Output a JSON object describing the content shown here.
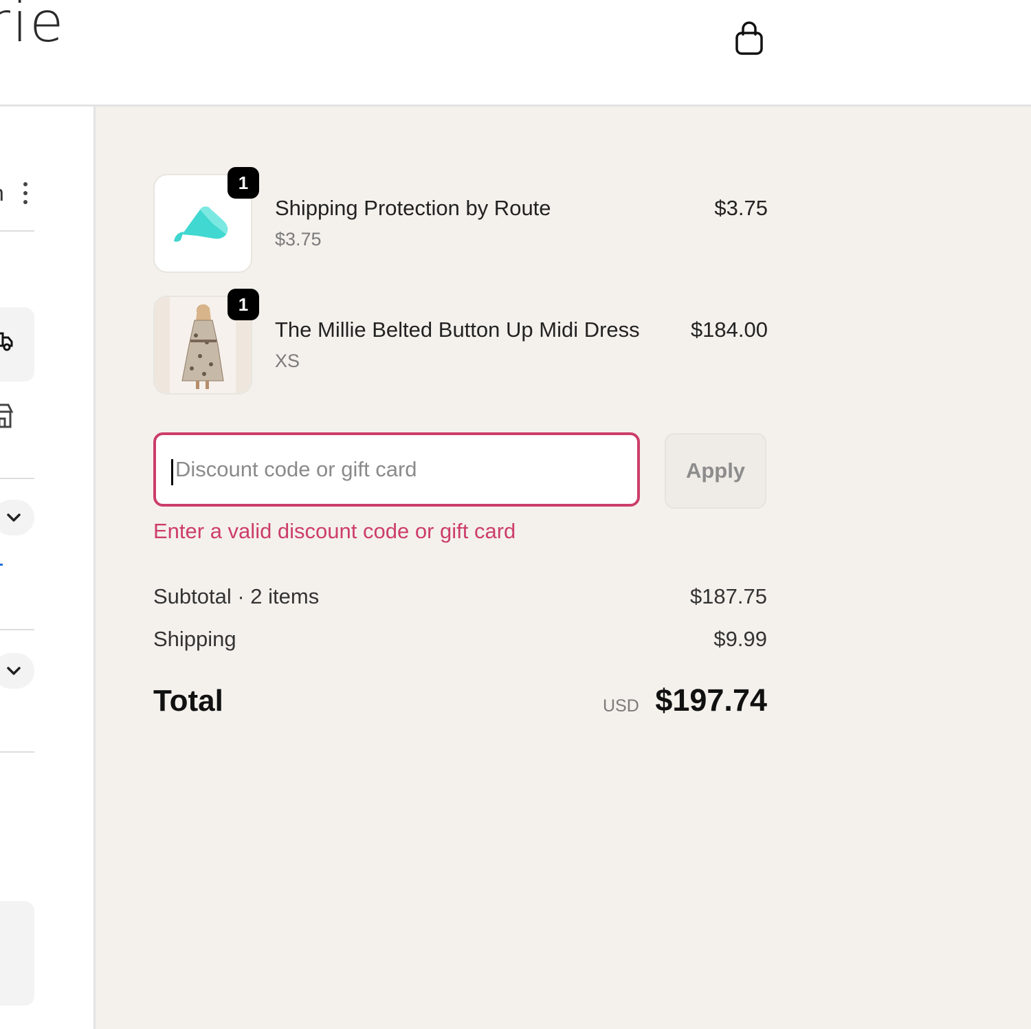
{
  "header": {
    "logo_text": "arie",
    "cart_icon": "shopping-bag-icon"
  },
  "left_panel": {
    "partial_text": "n",
    "icons": [
      "truck-icon",
      "store-icon",
      "chevron-down-icon",
      "chevron-down-icon",
      "more-vertical-icon"
    ]
  },
  "line_items": [
    {
      "name": "Shipping Protection by Route",
      "subtitle": "$3.75",
      "price": "$3.75",
      "quantity": "1",
      "image": "route-logo-icon"
    },
    {
      "name": "The Millie Belted Button Up Midi Dress",
      "subtitle": "XS",
      "price": "$184.00",
      "quantity": "1",
      "image": "dress-product-image"
    }
  ],
  "discount": {
    "placeholder": "Discount code or gift card",
    "value": "",
    "apply_label": "Apply",
    "error": "Enter a valid discount code or gift card"
  },
  "totals": {
    "subtotal_label": "Subtotal · 2 items",
    "subtotal_value": "$187.75",
    "shipping_label": "Shipping",
    "shipping_value": "$9.99",
    "total_label": "Total",
    "currency": "USD",
    "total_value": "$197.74"
  },
  "colors": {
    "error": "#cc3d6b",
    "summary_bg": "#f4f1ec",
    "route_teal": "#3fd6cf"
  }
}
